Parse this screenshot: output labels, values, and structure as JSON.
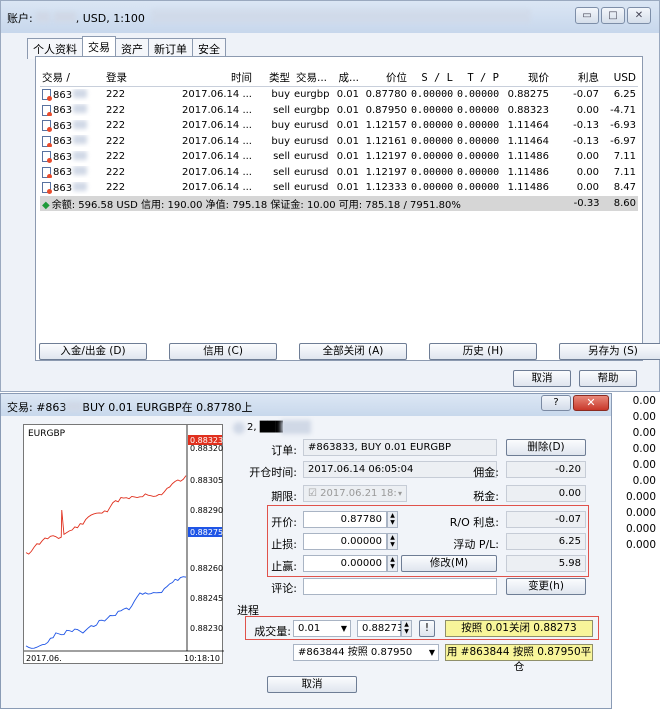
{
  "window": {
    "title": "账户: 6█████ 模拟, USD, 1:100",
    "title_prefix": "账户",
    "title_suffix": "USD, 1:100",
    "controls": [
      "▭",
      "□",
      "✕"
    ]
  },
  "tabs": [
    {
      "label": "个人资料",
      "active": false
    },
    {
      "label": "交易",
      "active": true
    },
    {
      "label": "资产",
      "active": false
    },
    {
      "label": "新订单",
      "active": false
    },
    {
      "label": "安全",
      "active": false
    }
  ],
  "table": {
    "headers": [
      "交易 /",
      "登录",
      "时间",
      "类型",
      "交易...",
      "成...",
      "价位",
      "S / L",
      "T / P",
      "现价",
      "利息",
      "USD"
    ],
    "rows": [
      [
        "863",
        "222",
        "2017.06.14 ...",
        "buy",
        "eurgbp",
        "0.01",
        "0.87780",
        "0.00000",
        "0.00000",
        "0.88275",
        "-0.07",
        "6.25"
      ],
      [
        "863",
        "222",
        "2017.06.14 ...",
        "sell",
        "eurgbp",
        "0.01",
        "0.87950",
        "0.00000",
        "0.00000",
        "0.88323",
        "0.00",
        "-4.71"
      ],
      [
        "863",
        "222",
        "2017.06.14 ...",
        "buy",
        "eurusd",
        "0.01",
        "1.12157",
        "0.00000",
        "0.00000",
        "1.11464",
        "-0.13",
        "-6.93"
      ],
      [
        "863",
        "222",
        "2017.06.14 ...",
        "buy",
        "eurusd",
        "0.01",
        "1.12161",
        "0.00000",
        "0.00000",
        "1.11464",
        "-0.13",
        "-6.97"
      ],
      [
        "863",
        "222",
        "2017.06.14 ...",
        "sell",
        "eurusd",
        "0.01",
        "1.12197",
        "0.00000",
        "0.00000",
        "1.11486",
        "0.00",
        "7.11"
      ],
      [
        "863",
        "222",
        "2017.06.14 ...",
        "sell",
        "eurusd",
        "0.01",
        "1.12197",
        "0.00000",
        "0.00000",
        "1.11486",
        "0.00",
        "7.11"
      ],
      [
        "863",
        "222",
        "2017.06.14 ...",
        "sell",
        "eurusd",
        "0.01",
        "1.12333",
        "0.00000",
        "0.00000",
        "1.11486",
        "0.00",
        "8.47"
      ]
    ],
    "summary": {
      "text": "余额: 596.58 USD  信用: 190.00  净值: 795.18  保证金: 10.00  可用: 785.18 / 7951.80%",
      "swap": "-0.33",
      "profit": "8.60"
    }
  },
  "bottom_buttons": [
    "入金/出金 (D)",
    "信用 (C)",
    "全部关闭 (A)",
    "历史 (H)",
    "另存为 (S)"
  ],
  "ok_buttons": [
    "取消",
    "帮助"
  ],
  "dialog": {
    "title": "交易: #863█ BUY 0.01 EURGBP在 0.87780上",
    "title_prefix": "交易: #863",
    "title_suffix": "BUY 0.01 EURGBP在 0.87780上",
    "help": "?",
    "close": "✕",
    "login_label": "2, ███",
    "order_label": "订单:",
    "order_value": "#863833, BUY 0.01 EURGBP",
    "delete_btn": "删除(D)",
    "open_time_label": "开仓时间:",
    "open_time_value": "2017.06.14 06:05:04",
    "commission_label": "佣金:",
    "commission_value": "-0.20",
    "expiry_label": "期限:",
    "expiry_value": "2017.06.21 18:",
    "tax_label": "税金:",
    "tax_value": "0.00",
    "open_price_label": "开价:",
    "open_price_value": "0.87780",
    "ro_swap_label": "R/O 利息:",
    "ro_swap_value": "-0.07",
    "sl_label": "止损:",
    "sl_value": "0.00000",
    "float_pl_label": "浮动 P/L:",
    "float_pl_value": "6.25",
    "tp_label": "止赢:",
    "tp_value": "0.00000",
    "modify_btn": "修改(M)",
    "tp_right_value": "5.98",
    "comment_label": "评论:",
    "change_btn": "变更(h)",
    "process_label": "进程",
    "volume_label": "成交量:",
    "volume_value": "0.01",
    "price_value": "0.88273",
    "close_by_btn": "按照 0.01关闭 0.88273",
    "closeby_select": "#863844 按照 0.87950",
    "closeby_btn": "用 #863844 按照 0.87950平仓",
    "cancel_btn": "取消"
  },
  "chart": {
    "symbol": "EURGBP",
    "ask_label": "0.88323",
    "bid_label": "0.88275",
    "ticks": [
      "0.88320",
      "0.88305",
      "0.88290",
      "0.88260",
      "0.88245",
      "0.88230"
    ],
    "date_left": "2017.06.",
    "time_right": "10:18:10",
    "ask_color": "#e0301e",
    "bid_color": "#1f55e6"
  },
  "right_column": [
    "0.00",
    "0.00",
    "0.00",
    "0.00",
    "0.00",
    "0.00",
    "0.000",
    "0.000",
    "0.000",
    "0.000"
  ]
}
